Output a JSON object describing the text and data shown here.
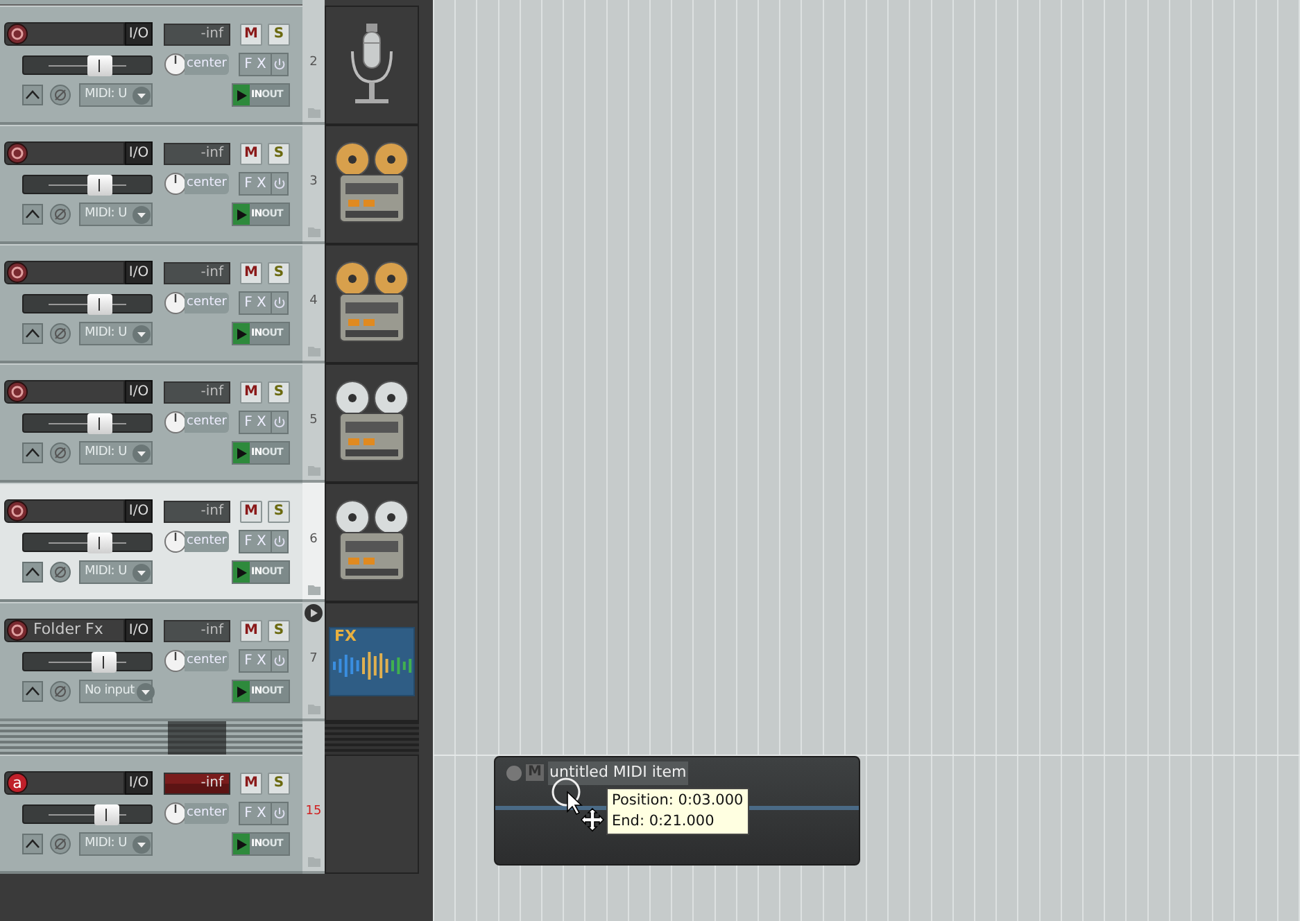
{
  "tracks": [
    {
      "number": "2",
      "selected": false,
      "folder": false,
      "rec_arm": {
        "armed": false
      },
      "io": "I/O",
      "meter": "-inf",
      "mute": "M",
      "solo": "S",
      "volume": {
        "level": 0.6
      },
      "pan": "center",
      "fx": "F X",
      "input": "MIDI: U",
      "monitor": {
        "on": true,
        "in": "IN",
        "out": "OUT"
      },
      "thumbnail": {
        "kind": "microphone"
      }
    },
    {
      "number": "3",
      "selected": false,
      "folder": false,
      "rec_arm": {
        "armed": false
      },
      "io": "I/O",
      "meter": "-inf",
      "mute": "M",
      "solo": "S",
      "volume": {
        "level": 0.6
      },
      "pan": "center",
      "fx": "F X",
      "input": "MIDI: U",
      "monitor": {
        "on": true,
        "in": "IN",
        "out": "OUT"
      },
      "thumbnail": {
        "kind": "tape-deck",
        "color": "#d8a04c"
      }
    },
    {
      "number": "4",
      "selected": false,
      "folder": false,
      "rec_arm": {
        "armed": false
      },
      "io": "I/O",
      "meter": "-inf",
      "mute": "M",
      "solo": "S",
      "volume": {
        "level": 0.6
      },
      "pan": "center",
      "fx": "F X",
      "input": "MIDI: U",
      "monitor": {
        "on": true,
        "in": "IN",
        "out": "OUT"
      },
      "thumbnail": {
        "kind": "tape-deck",
        "color": "#d8a04c"
      }
    },
    {
      "number": "5",
      "selected": false,
      "folder": false,
      "rec_arm": {
        "armed": false
      },
      "io": "I/O",
      "meter": "-inf",
      "mute": "M",
      "solo": "S",
      "volume": {
        "level": 0.6
      },
      "pan": "center",
      "fx": "F X",
      "input": "MIDI: U",
      "monitor": {
        "on": true,
        "in": "IN",
        "out": "OUT"
      },
      "thumbnail": {
        "kind": "tape-deck",
        "color": "#d8dcdc"
      }
    },
    {
      "number": "6",
      "selected": true,
      "folder": false,
      "rec_arm": {
        "armed": false
      },
      "io": "I/O",
      "meter": "-inf",
      "mute": "M",
      "solo": "S",
      "volume": {
        "level": 0.6
      },
      "pan": "center",
      "fx": "F X",
      "input": "MIDI: U",
      "monitor": {
        "on": true,
        "in": "IN",
        "out": "OUT"
      },
      "thumbnail": {
        "kind": "tape-deck",
        "color": "#d8dcdc"
      }
    },
    {
      "number": "7",
      "name": "Folder Fx",
      "selected": false,
      "folder": true,
      "rec_arm": {
        "armed": false
      },
      "io": "I/O",
      "meter": "-inf",
      "mute": "M",
      "solo": "S",
      "volume": {
        "level": 0.63
      },
      "pan": "center",
      "fx": "F X",
      "input": "No input",
      "monitor": {
        "on": true,
        "in": "IN",
        "out": "OUT"
      },
      "thumbnail": {
        "kind": "fx",
        "label": "FX"
      }
    },
    {
      "number": "15",
      "selected": false,
      "folder": false,
      "rec_arm": {
        "armed": true,
        "label": "a"
      },
      "io": "I/O",
      "meter": "-inf",
      "mute": "M",
      "solo": "S",
      "volume": {
        "level": 0.65
      },
      "pan": "center",
      "fx": "F X",
      "input": "MIDI: U",
      "monitor": {
        "on": true,
        "in": "IN",
        "out": "OUT"
      }
    }
  ],
  "midi_item": {
    "mute": "M",
    "title": "untitled MIDI item",
    "tooltip": [
      "Position: 0:03.000",
      "End: 0:21.000"
    ]
  }
}
